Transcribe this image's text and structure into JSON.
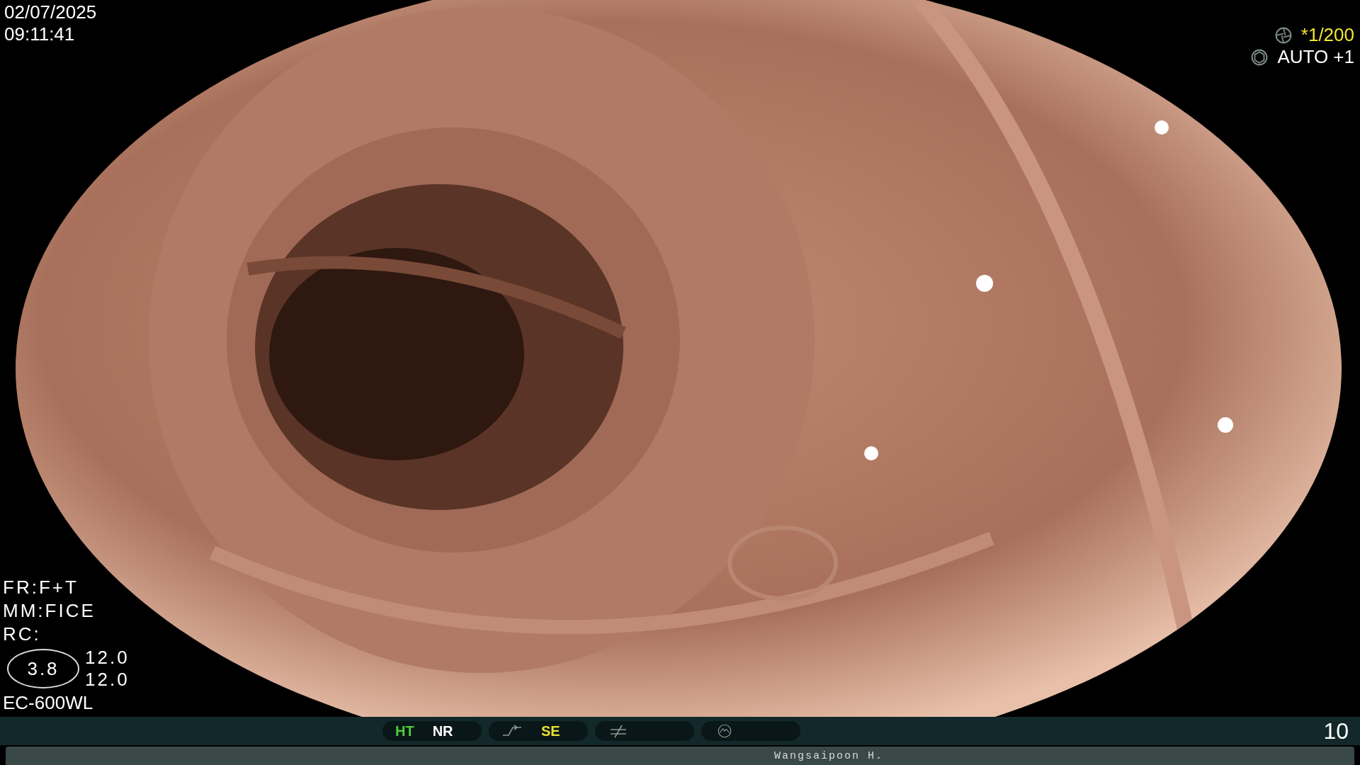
{
  "datetime": {
    "date": "02/07/2025",
    "time": "09:11:41"
  },
  "exposure": {
    "shutter": "*1/200",
    "iris": "AUTO +1"
  },
  "settings": [
    "FR:F+T",
    "MM:FICE",
    "RC:"
  ],
  "zoom_badge": "3.8",
  "readings": [
    "12.0",
    "12.0"
  ],
  "scope": "EC-600WL",
  "status_bar": {
    "groups": [
      {
        "kind": "text",
        "items": [
          {
            "text": "HT",
            "color": "#4ccc3c"
          },
          {
            "text": "NR",
            "color": "#ffffff"
          }
        ]
      },
      {
        "kind": "curve",
        "items": [
          {
            "text": "SE",
            "color": "#e8e030"
          }
        ]
      },
      {
        "kind": "not-equal"
      },
      {
        "kind": "mountain"
      }
    ],
    "frame_number": "10"
  },
  "operator": "Wangsaipoon H."
}
